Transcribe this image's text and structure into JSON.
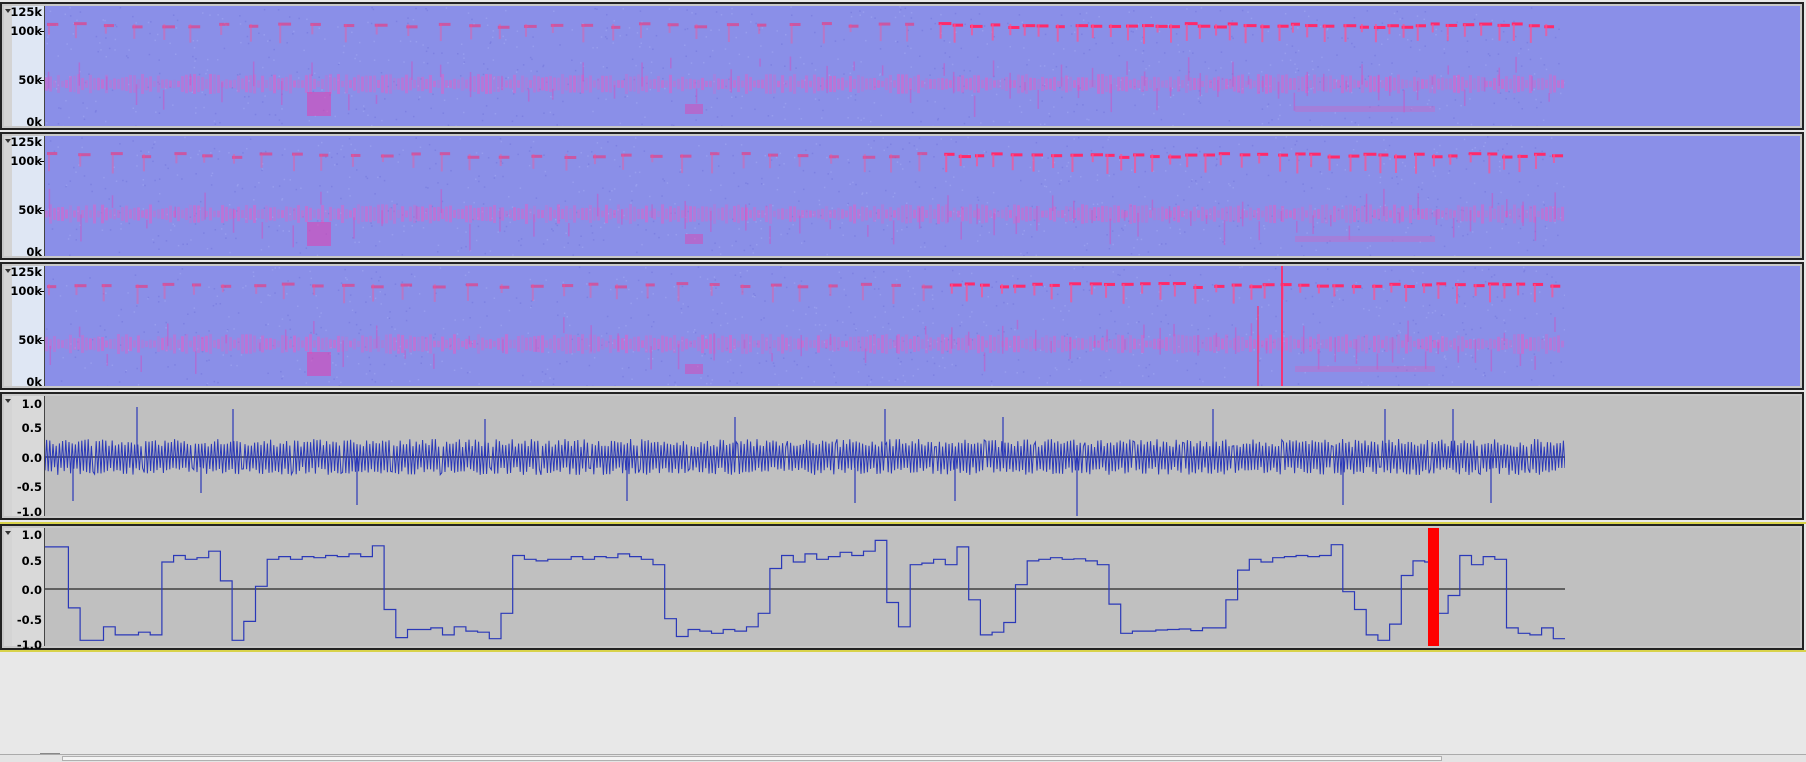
{
  "colors": {
    "spectrogram_base": "#8a8fe8",
    "spectrogram_hot": "#ff2a6a",
    "waveform_line": "#2a38b8",
    "waveform_bg": "#c0c0c0",
    "cursor_marker": "#ff0000",
    "selection_border": "#d8d24a"
  },
  "tracks": [
    {
      "kind": "spectrogram",
      "ticks": [
        "125k",
        "100k",
        "50k",
        "0k"
      ]
    },
    {
      "kind": "spectrogram",
      "ticks": [
        "125k",
        "100k",
        "50k",
        "0k"
      ]
    },
    {
      "kind": "spectrogram",
      "ticks": [
        "125k",
        "100k",
        "50k",
        "0k"
      ]
    },
    {
      "kind": "waveform",
      "ticks": [
        "1.0",
        "0.5",
        "0.0",
        "-0.5",
        "-1.0"
      ]
    },
    {
      "kind": "waveform-step",
      "ticks": [
        "1.0",
        "0.5",
        "0.0",
        "-0.5",
        "-1.0"
      ]
    }
  ],
  "step_values": [
    0.78,
    0.78,
    -0.35,
    -0.95,
    -0.95,
    -0.7,
    -0.85,
    -0.85,
    -0.8,
    -0.85,
    0.5,
    0.62,
    0.55,
    0.58,
    0.7,
    0.15,
    -0.95,
    -0.6,
    0.05,
    0.55,
    0.6,
    0.55,
    0.6,
    0.58,
    0.62,
    0.6,
    0.65,
    0.6,
    0.8,
    -0.38,
    -0.9,
    -0.75,
    -0.75,
    -0.72,
    -0.85,
    -0.7,
    -0.78,
    -0.8,
    -0.92,
    -0.45,
    0.62,
    0.55,
    0.52,
    0.55,
    0.55,
    0.6,
    0.55,
    0.6,
    0.58,
    0.65,
    0.6,
    0.55,
    0.45,
    -0.55,
    -0.88,
    -0.75,
    -0.78,
    -0.82,
    -0.75,
    -0.78,
    -0.7,
    -0.45,
    0.38,
    0.62,
    0.5,
    0.65,
    0.55,
    0.6,
    0.68,
    0.62,
    0.7,
    0.9,
    -0.25,
    -0.7,
    0.45,
    0.48,
    0.55,
    0.45,
    0.78,
    -0.2,
    -0.85,
    -0.8,
    -0.62,
    0.08,
    0.52,
    0.55,
    0.58,
    0.55,
    0.56,
    0.52,
    0.45,
    -0.28,
    -0.82,
    -0.78,
    -0.78,
    -0.76,
    -0.75,
    -0.74,
    -0.77,
    -0.72,
    -0.72,
    -0.2,
    0.35,
    0.55,
    0.5,
    0.58,
    0.6,
    0.62,
    0.6,
    0.62,
    0.82,
    -0.05,
    -0.38,
    -0.85,
    -0.95,
    -0.65,
    0.25,
    0.52,
    0.5,
    -0.45,
    -0.12,
    0.62,
    0.45,
    0.6,
    0.55,
    -0.72,
    -0.82,
    -0.85,
    -0.72,
    -0.92
  ]
}
